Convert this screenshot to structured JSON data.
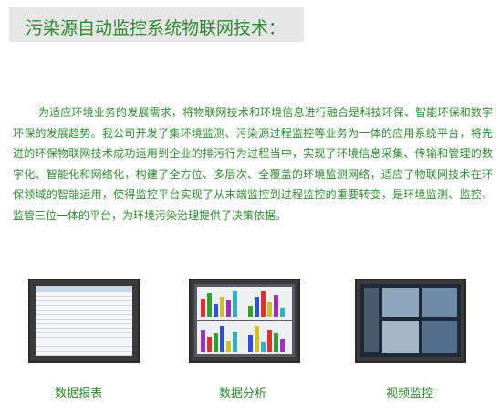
{
  "title": "污染源自动监控系统物联网技术：",
  "paragraph": "为适应环境业务的发展需求，将物联网技术和环境信息进行融合是科技环保、智能环保和数字环保的发展趋势。我公司开发了集环境监测、污染源过程监控等业务为一体的应用系统平台，将先进的环保物联网技术成功运用到企业的排污行为过程当中，实现了环境信息采集、传输和管理的数字化、智能化和网络化，构建了全方位、多层次、全覆盖的环境监测网络，适应了物联网技术在环保领域的智能运用，使得监控平台实现了从末端监控到过程监控的重要转变，是环境监测、监控、监管三位一体的平台，为环境污染治理提供了决策依据。",
  "items": [
    {
      "caption": "数据报表"
    },
    {
      "caption": "数据分析"
    },
    {
      "caption": "视频监控"
    }
  ]
}
